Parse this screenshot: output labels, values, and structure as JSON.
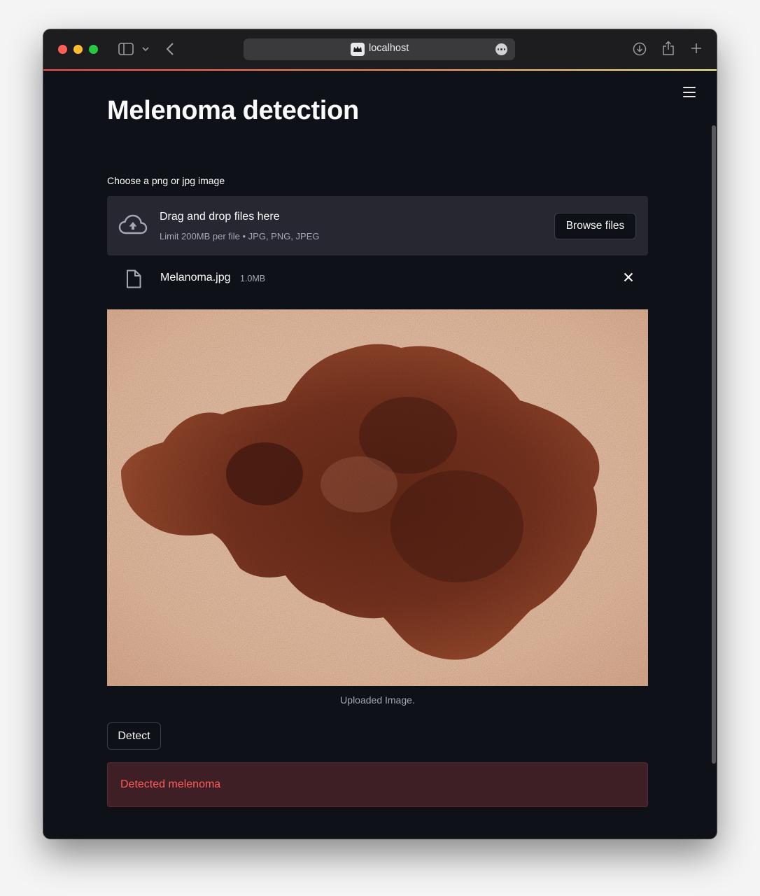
{
  "browser": {
    "address": "localhost",
    "icons": [
      "sidebar-icon",
      "chevron-down-icon",
      "back-icon",
      "site-icon",
      "more-icon",
      "download-icon",
      "share-icon",
      "new-tab-icon"
    ]
  },
  "app": {
    "title": "Melenoma detection",
    "uploader": {
      "label": "Choose a png or jpg image",
      "drop_text": "Drag and drop files here",
      "limit_text": "Limit 200MB per file • JPG, PNG, JPEG",
      "browse_label": "Browse files"
    },
    "file": {
      "name": "Melanoma.jpg",
      "size": "1.0MB"
    },
    "image_caption": "Uploaded Image.",
    "detect_label": "Detect",
    "result_text": "Detected melenoma",
    "colors": {
      "background": "#0e1117",
      "panel": "#262730",
      "error_bg": "#3e1f25",
      "error_text": "#ff5c5c"
    }
  }
}
